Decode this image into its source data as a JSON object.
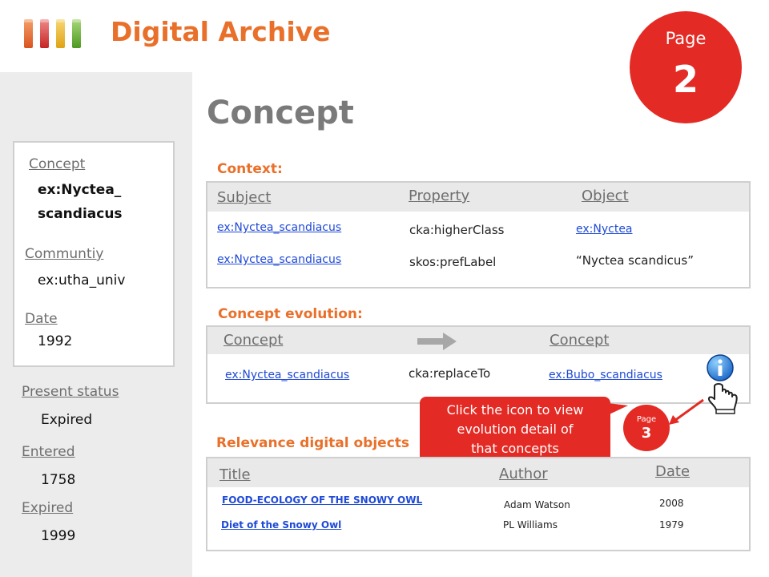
{
  "header": {
    "logo_icon": "colored-bars-logo-icon",
    "brand": "Digital Archive",
    "page_badge": {
      "label": "Page",
      "number": "2"
    },
    "page_title": "Concept"
  },
  "sidebar": {
    "concept_label": "Concept",
    "concept_value_line1": "ex:Nyctea_",
    "concept_value_line2": "scandiacus",
    "community_label": "Communtiy",
    "community_value": "ex:utha_univ",
    "date_label": "Date",
    "date_value": "1992",
    "present_status_label": "Present status",
    "present_status_value": "Expired",
    "entered_label": "Entered",
    "entered_value": "1758",
    "expired_label": "Expired",
    "expired_value": "1999"
  },
  "context": {
    "heading": "Context:",
    "columns": [
      "Subject",
      "Property",
      "Object"
    ],
    "rows": [
      {
        "subject": "ex:Nyctea_scandiacus",
        "property": "cka:higherClass",
        "object": "ex:Nyctea"
      },
      {
        "subject": "ex:Nyctea_scandiacus",
        "property": "skos:prefLabel",
        "object": "“Nyctea scandicus”"
      }
    ]
  },
  "evolution": {
    "heading": "Concept evolution:",
    "from_label": "Concept",
    "to_label": "Concept",
    "from_value": "ex:Nyctea_scandiacus",
    "relation": "cka:replaceTo",
    "to_value": "ex:Bubo_scandiacus",
    "arrow_icon": "arrow-right-icon",
    "info_icon": "info-hand-cursor-icon"
  },
  "callout": {
    "line1": "Click the icon to view",
    "line2": "evolution detail of",
    "line3": "that concepts",
    "page_badge": {
      "label": "Page",
      "number": "3"
    }
  },
  "relevance": {
    "heading": "Relevance digital objects",
    "columns": [
      "Title",
      "Author",
      "Date"
    ],
    "rows": [
      {
        "title": "FOOD-ECOLOGY OF THE SNOWY OWL",
        "author": "Adam Watson",
        "date": "2008"
      },
      {
        "title": "Diet of the Snowy Owl",
        "author": "PL Williams",
        "date": "1979"
      }
    ]
  },
  "colors": {
    "accent_orange": "#e9702a",
    "badge_red": "#e42a24",
    "link_blue": "#1f4ad6",
    "label_gray": "#6e6e6e",
    "panel_border": "#cfcfcf",
    "sidebar_bg": "#ececec"
  }
}
